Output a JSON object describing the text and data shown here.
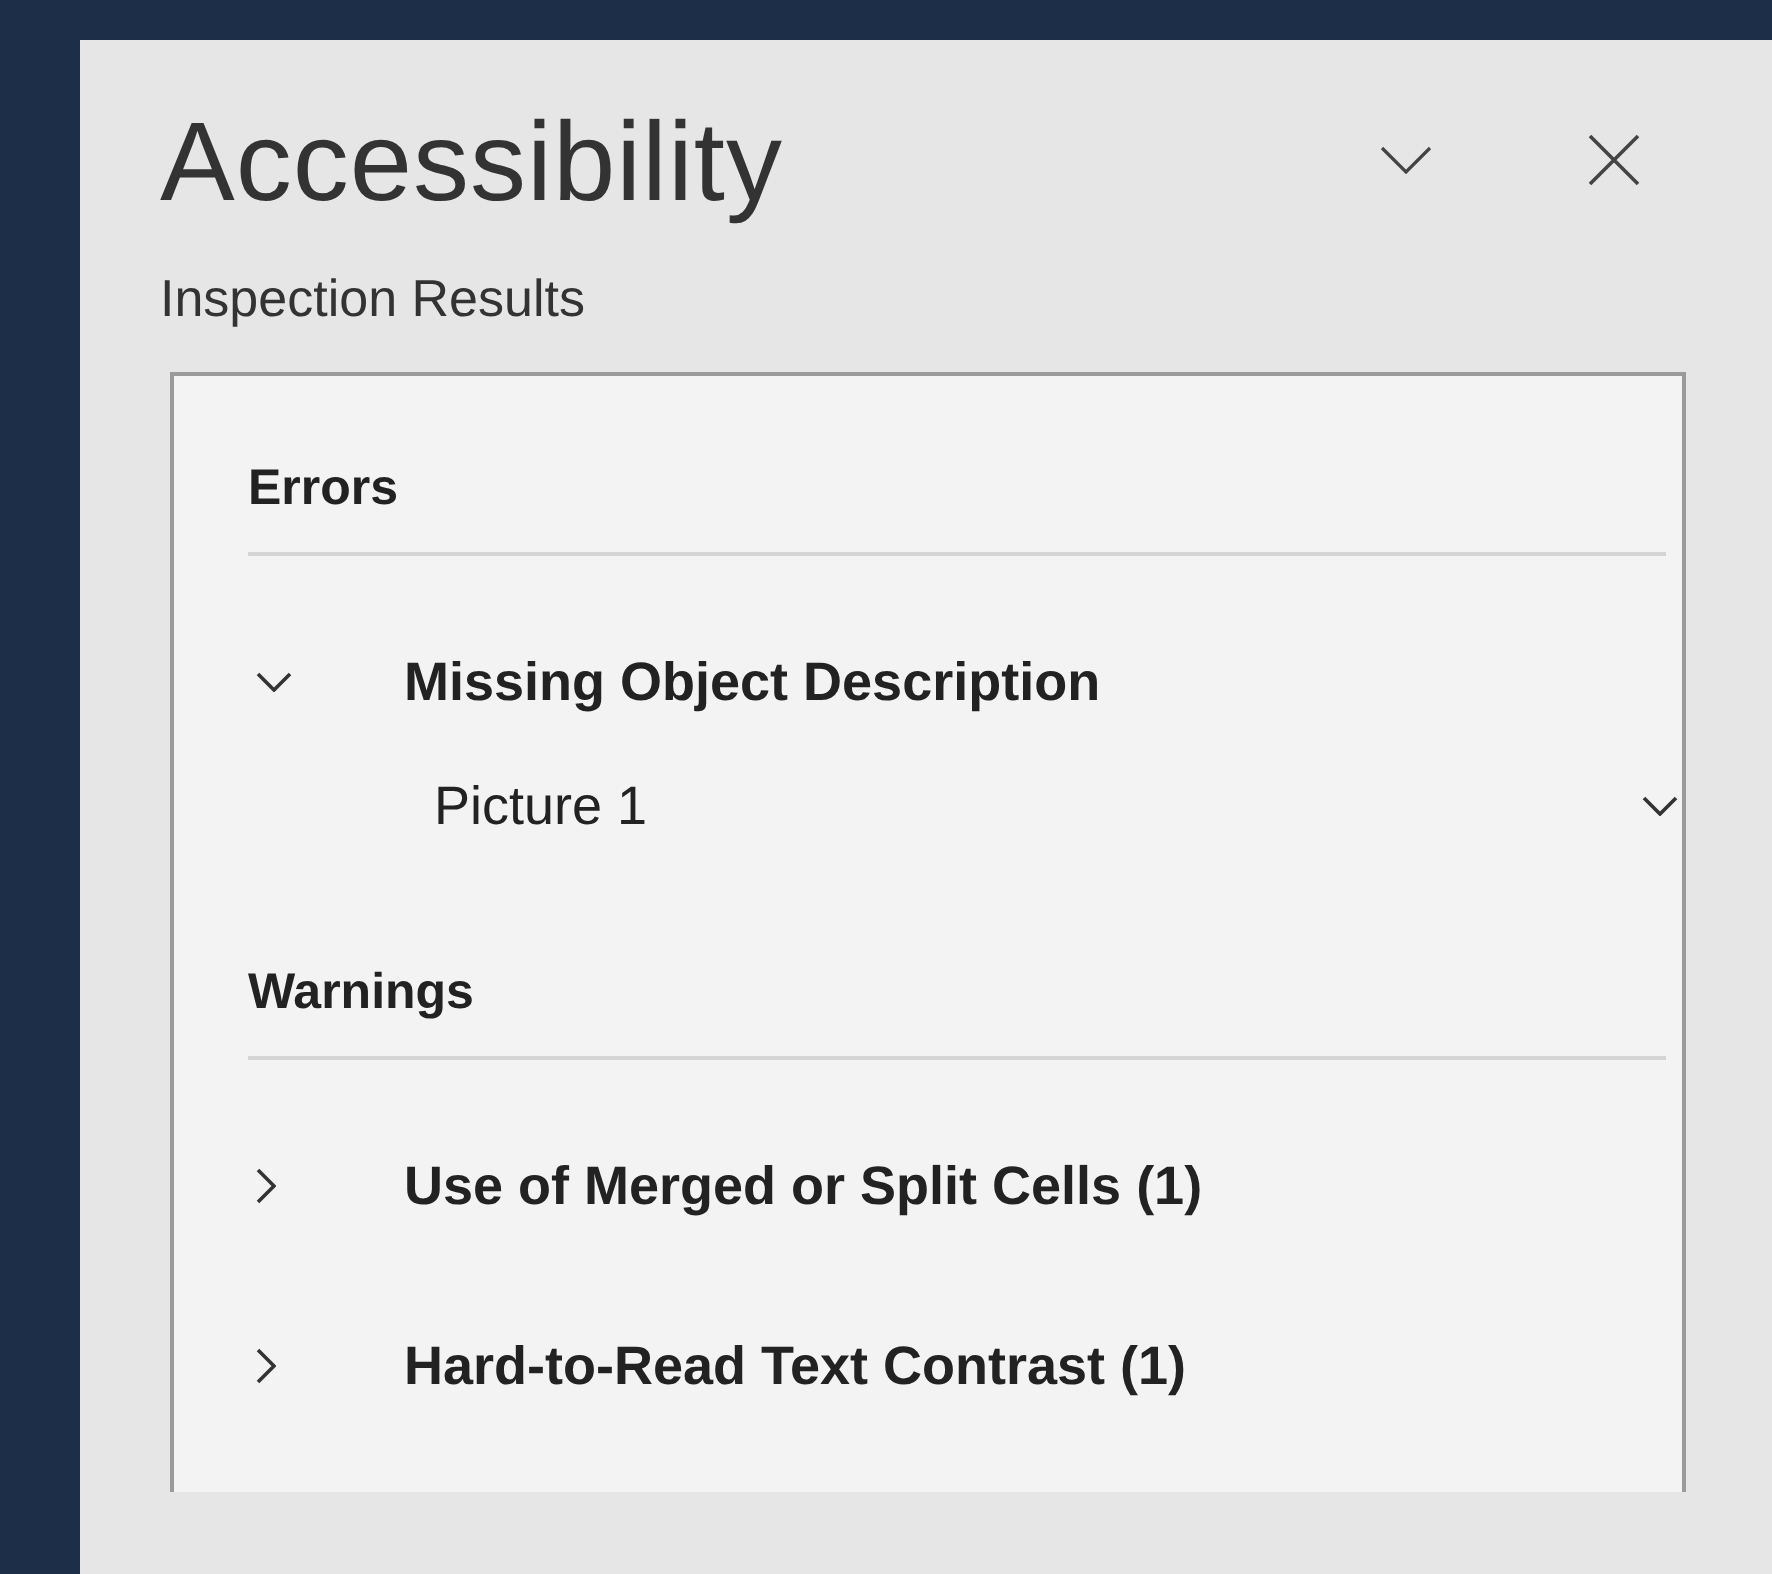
{
  "panel": {
    "title": "Accessibility",
    "subtitle": "Inspection Results"
  },
  "groups": [
    {
      "heading": "Errors",
      "issues": [
        {
          "label": "Missing Object Description",
          "expanded": true,
          "children": [
            {
              "label": "Picture 1"
            }
          ]
        }
      ]
    },
    {
      "heading": "Warnings",
      "issues": [
        {
          "label": "Use of Merged or Split Cells (1)",
          "expanded": false
        },
        {
          "label": "Hard-to-Read Text Contrast (1)",
          "expanded": false
        }
      ]
    }
  ]
}
